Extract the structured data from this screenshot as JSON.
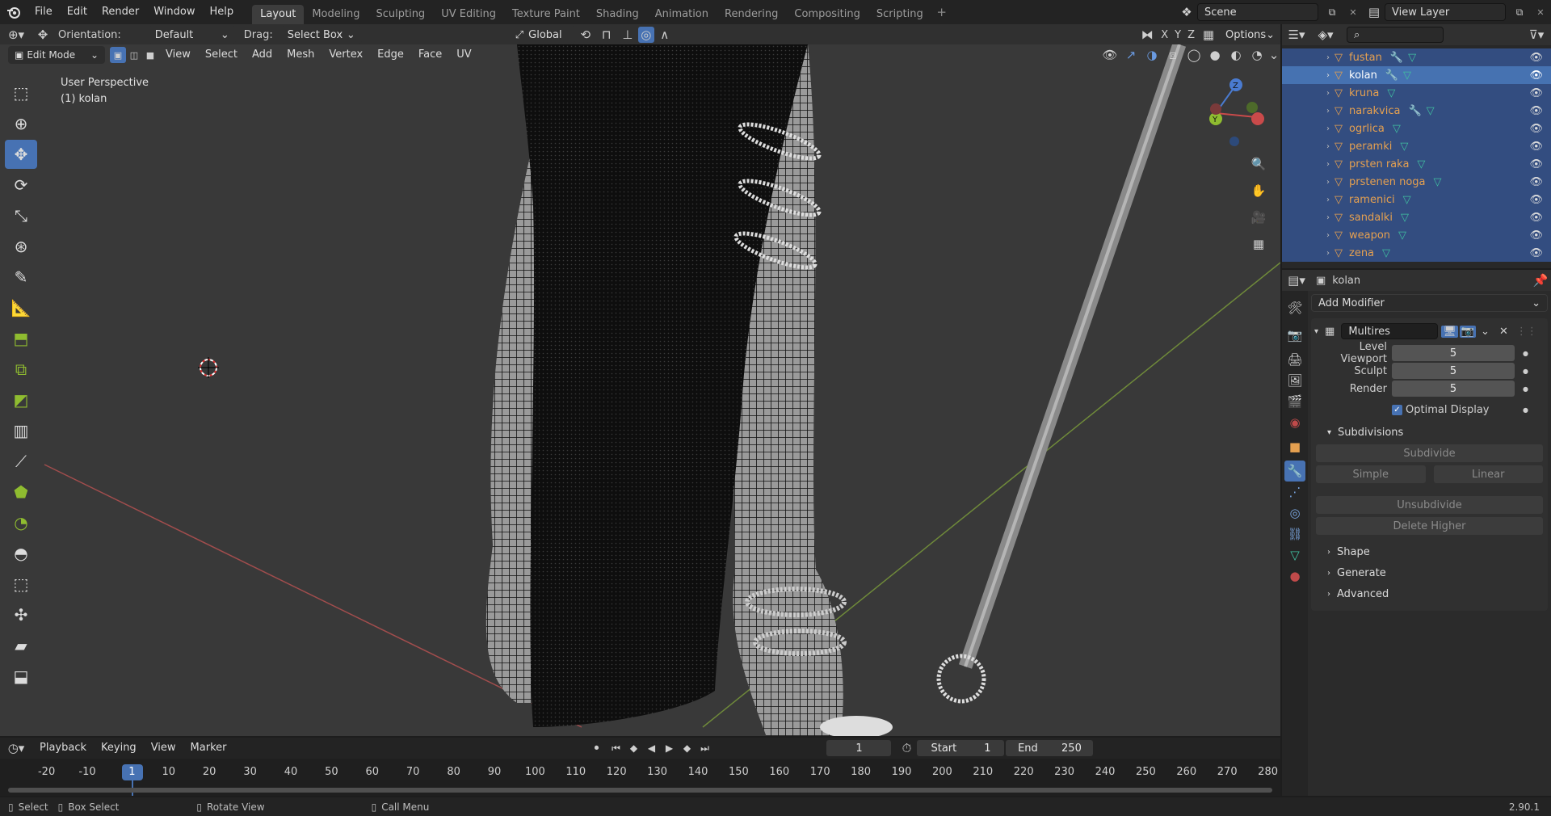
{
  "topbar": {
    "menus": [
      "File",
      "Edit",
      "Render",
      "Window",
      "Help"
    ],
    "workspaces": [
      "Layout",
      "Modeling",
      "Sculpting",
      "UV Editing",
      "Texture Paint",
      "Shading",
      "Animation",
      "Rendering",
      "Compositing",
      "Scripting"
    ],
    "active_workspace": "Layout",
    "scene": "Scene",
    "view_layer": "View Layer"
  },
  "viewport": {
    "orientation_label": "Orientation:",
    "orientation_value": "Default",
    "drag_label": "Drag:",
    "drag_value": "Select Box",
    "transform_orientation": "Global",
    "options": "Options",
    "axis_x": "X",
    "axis_y": "Y",
    "axis_z": "Z",
    "mode": "Edit Mode",
    "header_menus": [
      "View",
      "Select",
      "Add",
      "Mesh",
      "Vertex",
      "Edge",
      "Face",
      "UV"
    ],
    "overlay_title": "User Perspective",
    "overlay_object": "(1) kolan"
  },
  "outliner": {
    "items": [
      {
        "name": "fustan",
        "modifier": true
      },
      {
        "name": "kolan",
        "modifier": true,
        "selected": true
      },
      {
        "name": "kruna",
        "modifier": false
      },
      {
        "name": "narakvica",
        "modifier": true
      },
      {
        "name": "ogrlica",
        "modifier": false
      },
      {
        "name": "peramki",
        "modifier": false
      },
      {
        "name": "prsten raka",
        "modifier": false
      },
      {
        "name": "prstenen noga",
        "modifier": false
      },
      {
        "name": "ramenici",
        "modifier": false
      },
      {
        "name": "sandalki",
        "modifier": false
      },
      {
        "name": "weapon",
        "modifier": false
      },
      {
        "name": "zena",
        "modifier": false
      }
    ]
  },
  "properties": {
    "object_name": "kolan",
    "add_modifier": "Add Modifier",
    "modifier_name": "Multires",
    "level_viewport_label": "Level Viewport",
    "level_viewport": "5",
    "sculpt_label": "Sculpt",
    "sculpt": "5",
    "render_label": "Render",
    "render": "5",
    "optimal_display": "Optimal Display",
    "subdivisions": "Subdivisions",
    "subdivide": "Subdivide",
    "simple": "Simple",
    "linear": "Linear",
    "unsubdivide": "Unsubdivide",
    "delete_higher": "Delete Higher",
    "shape": "Shape",
    "generate": "Generate",
    "advanced": "Advanced"
  },
  "timeline": {
    "menus": [
      "Playback",
      "Keying",
      "View",
      "Marker"
    ],
    "current_frame": "1",
    "start_label": "Start",
    "start": "1",
    "end_label": "End",
    "end": "250",
    "ticks": [
      "-20",
      "-10",
      "1",
      "10",
      "20",
      "30",
      "40",
      "50",
      "60",
      "70",
      "80",
      "90",
      "100",
      "110",
      "120",
      "130",
      "140",
      "150",
      "160",
      "170",
      "180",
      "190",
      "200",
      "210",
      "220",
      "230",
      "240",
      "250",
      "260",
      "270",
      "280"
    ]
  },
  "status": {
    "select": "Select",
    "box_select": "Box Select",
    "rotate_view": "Rotate View",
    "call_menu": "Call Menu",
    "version": "2.90.1"
  },
  "colors": {
    "accent": "#4772b3",
    "outliner_bg": "#334d80",
    "object_orange": "#e5a050"
  }
}
